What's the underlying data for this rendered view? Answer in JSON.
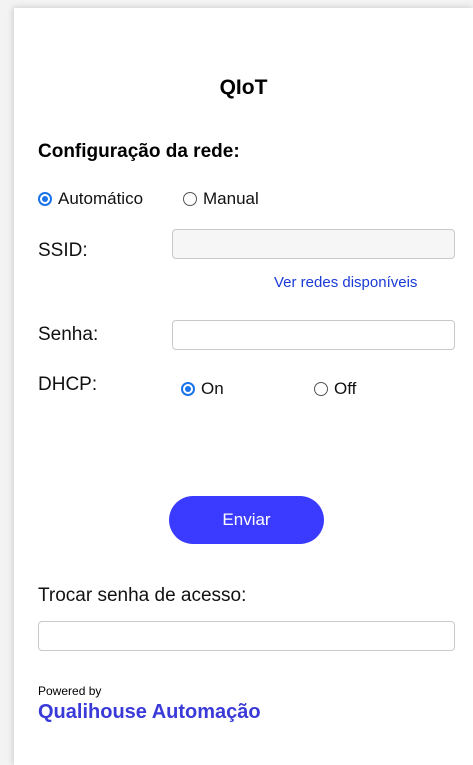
{
  "title": "QIoT",
  "network": {
    "heading": "Configuração da rede:",
    "mode_options": [
      {
        "label": "Automático",
        "checked": true
      },
      {
        "label": "Manual",
        "checked": false
      }
    ],
    "ssid_label": "SSID:",
    "ssid_value": "",
    "view_networks_link": "Ver redes disponíveis",
    "password_label": "Senha:",
    "password_value": "",
    "dhcp_label": "DHCP:",
    "dhcp_options": [
      {
        "label": "On",
        "checked": true
      },
      {
        "label": "Off",
        "checked": false
      }
    ]
  },
  "submit_label": "Enviar",
  "change_password": {
    "label": "Trocar senha de acesso:",
    "value": ""
  },
  "footer": {
    "powered_by": "Powered by",
    "brand": "Qualihouse Automação"
  },
  "colors": {
    "accent": "#3b3bff",
    "link": "#1a3ad6",
    "brand": "#3a3ad9",
    "radio": "#1a73e8"
  }
}
